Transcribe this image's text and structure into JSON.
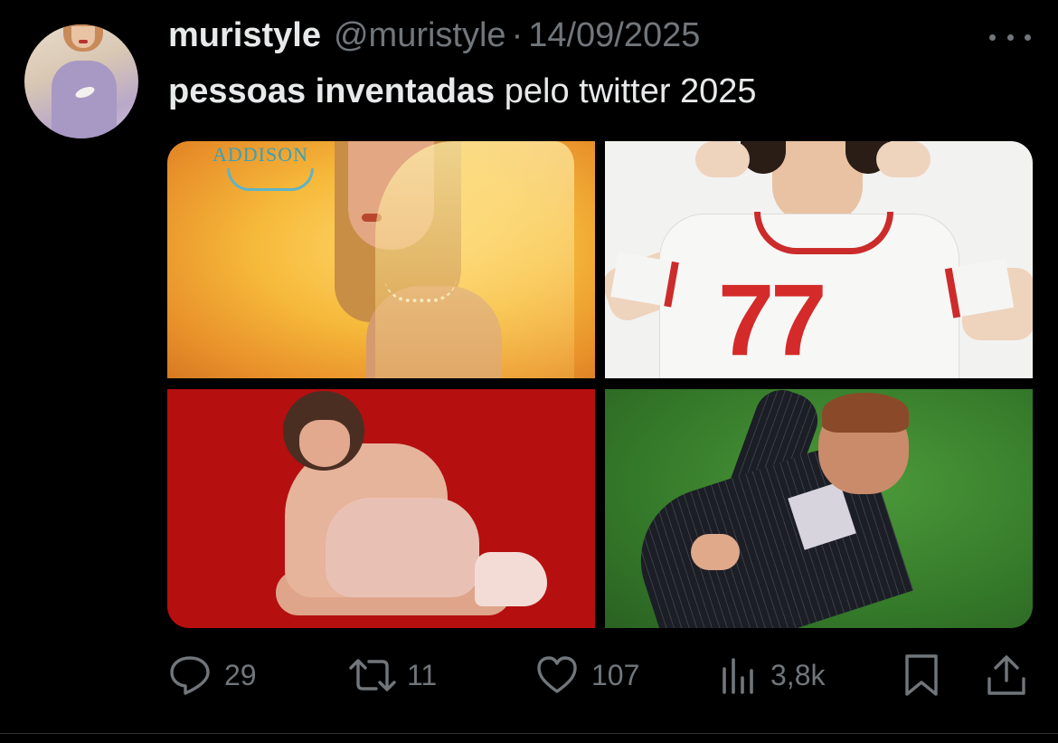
{
  "tweet": {
    "author": {
      "display_name": "muristyle",
      "handle": "@muristyle",
      "separator": "·",
      "date": "14/09/2025"
    },
    "text": {
      "bold": "pessoas inventadas",
      "rest": " pelo twitter 2025"
    },
    "media": {
      "tile1_logo_text": "ADDISON",
      "tile2_shirt_number": "77"
    },
    "actions": {
      "replies": "29",
      "reposts": "11",
      "likes": "107",
      "views": "3,8k"
    }
  },
  "colors": {
    "background": "#000000",
    "text_primary": "#e7e9ea",
    "text_secondary": "#71767b"
  },
  "icons": [
    "more-icon",
    "reply-icon",
    "repost-icon",
    "like-icon",
    "views-icon",
    "bookmark-icon",
    "share-icon"
  ]
}
